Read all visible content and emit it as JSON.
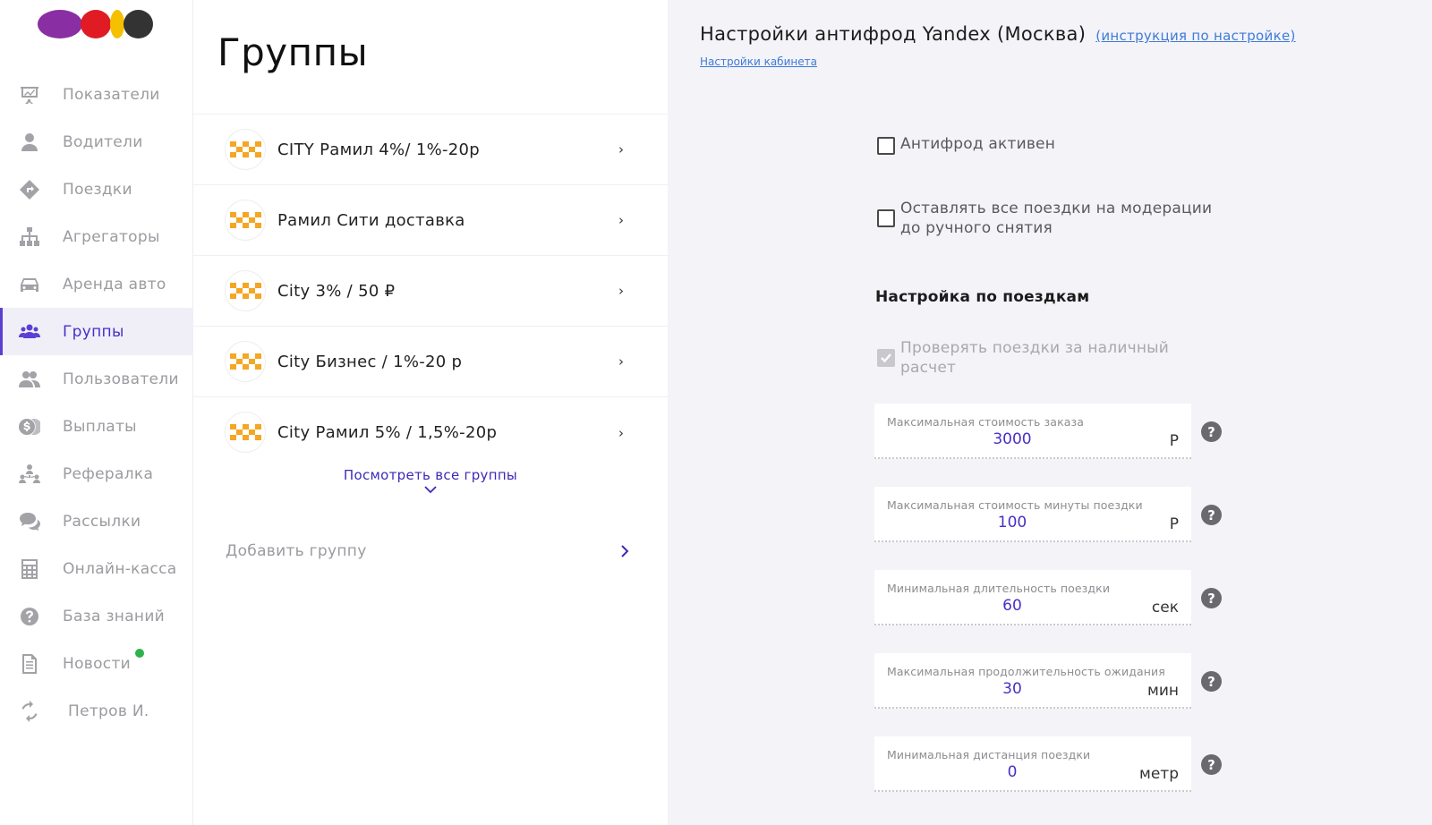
{
  "sidebar": {
    "items": [
      {
        "label": "Показатели",
        "icon": "chart-board-icon"
      },
      {
        "label": "Водители",
        "icon": "person-icon"
      },
      {
        "label": "Поездки",
        "icon": "route-sign-icon"
      },
      {
        "label": "Агрегаторы",
        "icon": "hierarchy-icon"
      },
      {
        "label": "Аренда авто",
        "icon": "car-icon"
      },
      {
        "label": "Группы",
        "icon": "users-group-icon",
        "active": true
      },
      {
        "label": "Пользователи",
        "icon": "users-icon"
      },
      {
        "label": "Выплаты",
        "icon": "coins-icon"
      },
      {
        "label": "Рефералка",
        "icon": "referral-icon"
      },
      {
        "label": "Рассылки",
        "icon": "chat-bubbles-icon"
      },
      {
        "label": "Онлайн-касса",
        "icon": "calculator-icon"
      },
      {
        "label": "База знаний",
        "icon": "question-circle-icon"
      },
      {
        "label": "Новости",
        "icon": "document-icon",
        "badge": true
      },
      {
        "label": "Петров И.",
        "icon": "refresh-icon"
      }
    ]
  },
  "groups": {
    "title": "Группы",
    "items": [
      {
        "name": "CITY Рамил 4%/ 1%-20р"
      },
      {
        "name": "Рамил Сити доставка"
      },
      {
        "name": "City 3% / 50 ₽"
      },
      {
        "name": "City Бизнес / 1%-20 р"
      },
      {
        "name": "City Рамил 5% / 1,5%-20р"
      }
    ],
    "see_all": "Посмотреть все группы",
    "add_group": "Добавить группу"
  },
  "settings": {
    "title": "Настройки антифрод Yandex (Москва)",
    "instruction_link": "(инструкция по настройке)",
    "cabinet_link": "Настройки кабинета",
    "antifraud_active": {
      "label": "Антифрод активен",
      "checked": false
    },
    "moderation": {
      "line1": "Оставлять все поездки на модерации",
      "line2": "до ручного снятия",
      "checked": false
    },
    "section_title": "Настройка по поездкам",
    "cash_check": {
      "line1": "Проверять поездки за наличный",
      "line2": "расчет",
      "checked": true,
      "disabled": true
    },
    "fields": [
      {
        "label": "Максимальная стоимость заказа",
        "value": "3000",
        "unit": "Р"
      },
      {
        "label": "Максимальная стоимость минуты поездки",
        "value": "100",
        "unit": "Р"
      },
      {
        "label": "Минимальная длительность поездки",
        "value": "60",
        "unit": "сек"
      },
      {
        "label": "Максимальная продолжительность ожидания",
        "value": "30",
        "unit": "мин"
      },
      {
        "label": "Минимальная дистанция поездки",
        "value": "0",
        "unit": "метр"
      }
    ]
  },
  "colors": {
    "accent": "#4a2fc4",
    "link": "#3f7bd8",
    "taxi_orange": "#f5a623",
    "news_badge": "#2fb24c"
  }
}
